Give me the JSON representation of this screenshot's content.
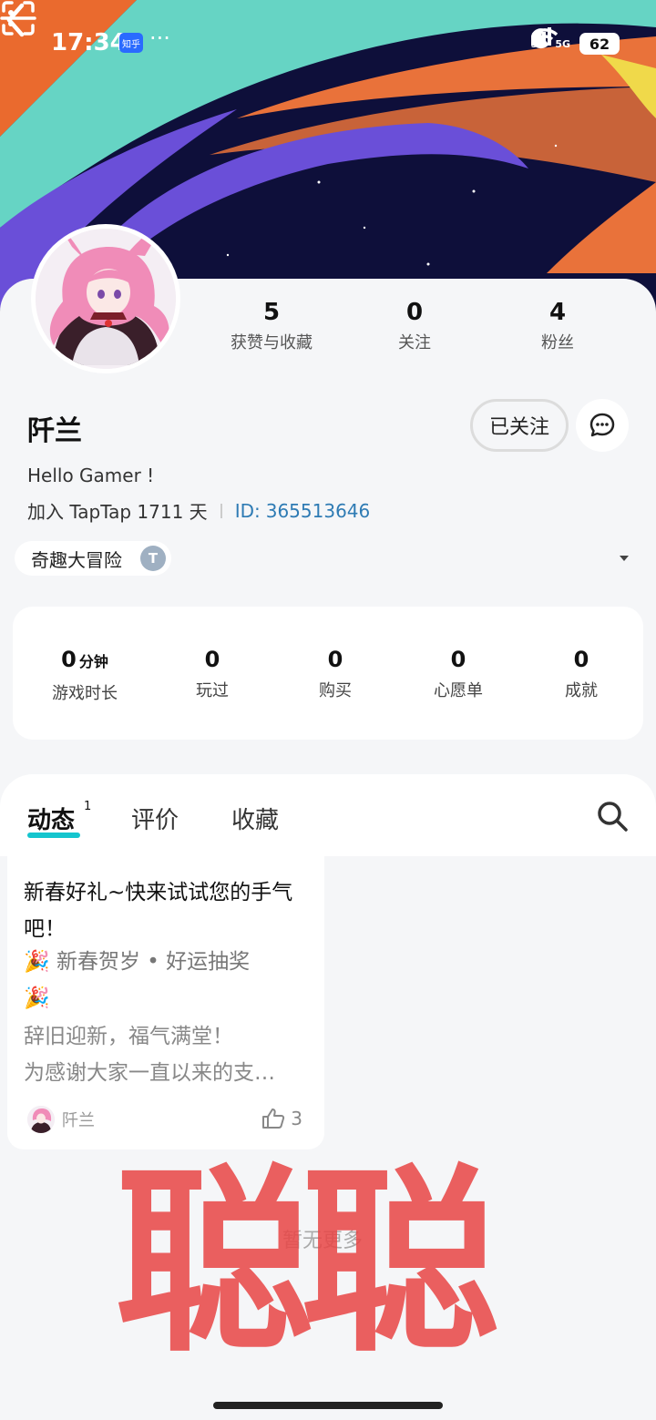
{
  "status_bar": {
    "time": "17:34",
    "app_badge": "知乎",
    "more": "···",
    "network_1": "5G",
    "network_2": "5G",
    "battery": "62"
  },
  "header": {
    "icons": [
      "back-icon",
      "scan-icon",
      "more-vertical-icon"
    ]
  },
  "profile": {
    "stats": [
      {
        "value": "5",
        "label": "获赞与收藏"
      },
      {
        "value": "0",
        "label": "关注"
      },
      {
        "value": "4",
        "label": "粉丝"
      }
    ],
    "name": "阡兰",
    "follow_label": "已关注",
    "bio": "Hello Gamer !",
    "join_text": "加入 TapTap 1711 天",
    "id_label": "ID:",
    "id_value": "365513646",
    "badge": "奇趣大冒险",
    "badge_logo": "T"
  },
  "game_stats": [
    {
      "value": "0",
      "unit": "分钟",
      "label": "游戏时长"
    },
    {
      "value": "0",
      "unit": "",
      "label": "玩过"
    },
    {
      "value": "0",
      "unit": "",
      "label": "购买"
    },
    {
      "value": "0",
      "unit": "",
      "label": "心愿单"
    },
    {
      "value": "0",
      "unit": "",
      "label": "成就"
    }
  ],
  "tabs": {
    "items": [
      "动态",
      "评价",
      "收藏"
    ],
    "active_count": "1"
  },
  "feed": {
    "title": "新春好礼~快来试试您的手气吧！",
    "tags_line": "🎉 新春贺岁 • 好运抽奖",
    "tags_line2": "🎉",
    "body_line1": "辞旧迎新，福气满堂！",
    "body_line2": "为感谢大家一直以来的支…",
    "author": "阡兰",
    "likes": "3"
  },
  "empty_text": "暂无更多",
  "watermark": "聪聪",
  "colors": {
    "accent": "#15c5ce",
    "id_blue": "#2e7bb4",
    "watermark_red": "#e84646"
  }
}
